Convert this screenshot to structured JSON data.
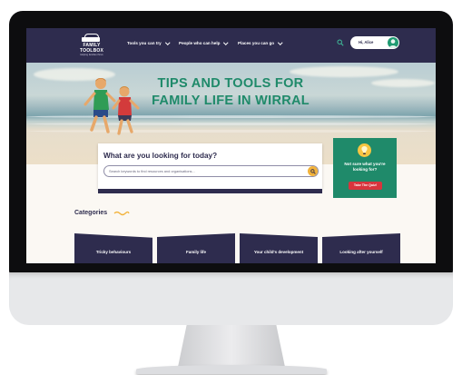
{
  "header": {
    "logo_title_1": "FAMILY",
    "logo_title_2": "TOOLBOX",
    "logo_tagline": "Helping families thrive",
    "nav": [
      {
        "label": "Tools you can try"
      },
      {
        "label": "People who can help"
      },
      {
        "label": "Places you can go"
      }
    ],
    "user_name": "Hi, Alice"
  },
  "hero": {
    "title_line_1": "TIPS AND TOOLS FOR",
    "title_line_2": "FAMILY LIFE IN WIRRAL"
  },
  "search": {
    "question": "What are you looking for today?",
    "placeholder": "Search keywords to find resources and organisations..."
  },
  "quiz": {
    "text": "Not sure what you're looking for?",
    "button": "Take The Quiz!"
  },
  "categories": {
    "title": "Categories",
    "items": [
      {
        "label": "Tricky behaviours"
      },
      {
        "label": "Family life"
      },
      {
        "label": "Your child's development"
      },
      {
        "label": "Looking after yourself"
      }
    ]
  },
  "colors": {
    "brand_dark": "#2e2c4e",
    "brand_green": "#1f8a6a",
    "accent_yellow": "#f2b23a",
    "accent_red": "#d8343d"
  },
  "icons": [
    "search-icon",
    "avatar-icon",
    "chevron-down-icon",
    "lightbulb-icon",
    "squiggle-icon"
  ]
}
